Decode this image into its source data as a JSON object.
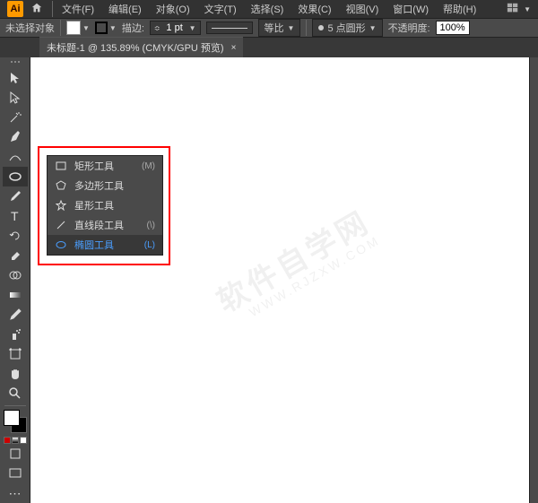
{
  "menubar": {
    "logo": "Ai",
    "items": [
      "文件(F)",
      "编辑(E)",
      "对象(O)",
      "文字(T)",
      "选择(S)",
      "效果(C)",
      "视图(V)",
      "窗口(W)",
      "帮助(H)"
    ]
  },
  "optionsbar": {
    "no_selection": "未选择对象",
    "stroke_label": "描边:",
    "stroke_value": "1 pt",
    "scale_label": "等比",
    "brush_label": "5 点圆形",
    "opacity_label": "不透明度:",
    "opacity_value": "100%"
  },
  "tab": {
    "title": "未标题-1 @ 135.89% (CMYK/GPU 预览)"
  },
  "flyout": {
    "items": [
      {
        "icon": "rect",
        "label": "矩形工具",
        "shortcut": "(M)"
      },
      {
        "icon": "polygon",
        "label": "多边形工具",
        "shortcut": ""
      },
      {
        "icon": "star",
        "label": "星形工具",
        "shortcut": ""
      },
      {
        "icon": "line",
        "label": "直线段工具",
        "shortcut": "(\\)"
      },
      {
        "icon": "ellipse",
        "label": "椭圆工具",
        "shortcut": "(L)"
      }
    ]
  },
  "watermark": {
    "big": "软件自学网",
    "small": "WWW.RJZXW.COM"
  }
}
